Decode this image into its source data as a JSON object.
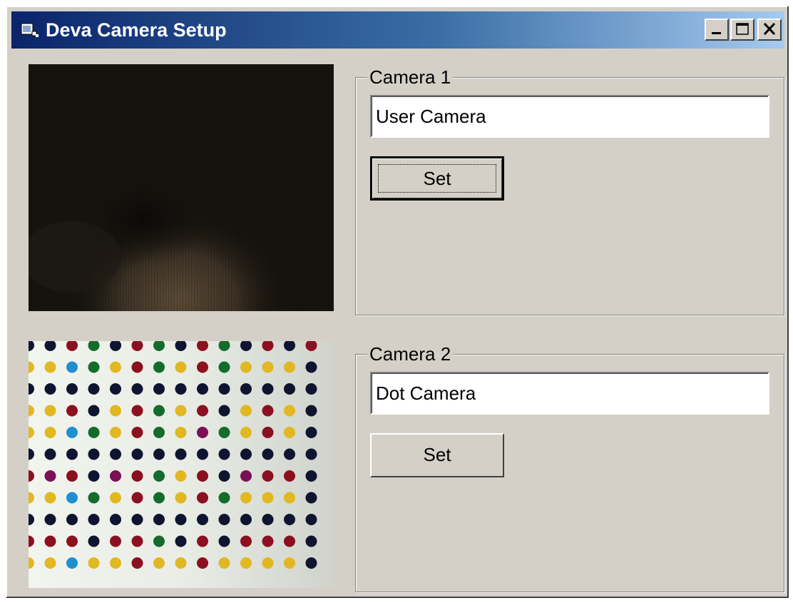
{
  "window": {
    "title": "Deva Camera Setup",
    "icon": "camera-app-icon",
    "controls": [
      "minimize-icon",
      "maximize-icon",
      "close-icon"
    ]
  },
  "cameras": [
    {
      "group_label": "Camera 1",
      "name_value": "User Camera",
      "set_label": "Set",
      "preview": "dark-webcam-frame"
    },
    {
      "group_label": "Camera 2",
      "name_value": "Dot Camera",
      "set_label": "Set",
      "preview": "colored-dot-grid-frame"
    }
  ],
  "colors": {
    "face": "#d4d0c8",
    "titlebar_start": "#0a246a",
    "titlebar_end": "#a6caf0",
    "dot_colors": [
      "#0f1430",
      "#8b1020",
      "#146c2c",
      "#e2b822",
      "#1f8fd0",
      "#7a1055"
    ]
  }
}
